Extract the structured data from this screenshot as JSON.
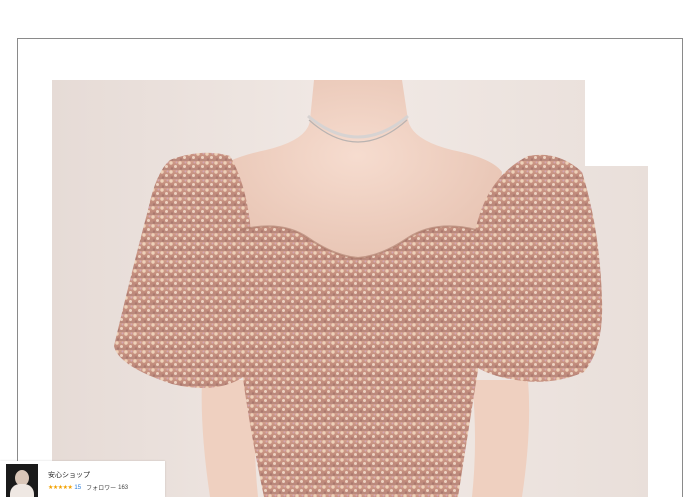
{
  "product_image": {
    "subject": "sequin-puff-sleeve-dress",
    "colors": {
      "background_wall": "#eee4df",
      "sequin_base": "#c89080",
      "sequin_highlight": "#f3dcc0",
      "skin": "#f1d4c5"
    }
  },
  "shop": {
    "name": "安心ショップ",
    "stars": "★★★★★",
    "rating_count": "15",
    "followers_label": "フォロワー",
    "followers_count": "163"
  }
}
